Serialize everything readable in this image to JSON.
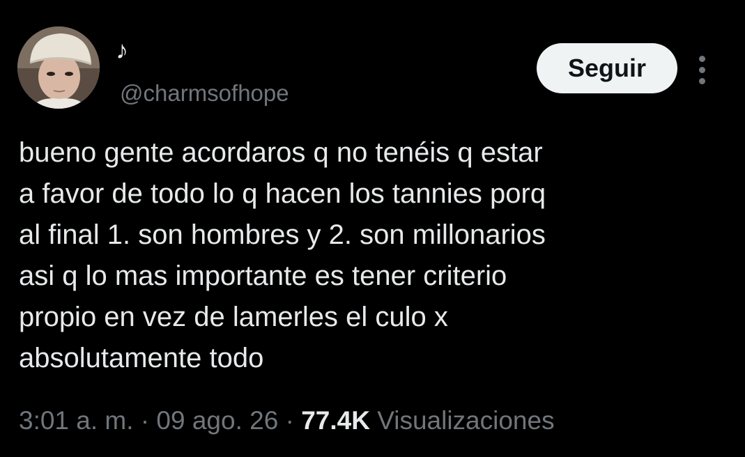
{
  "author": {
    "display_name": "♪",
    "handle": "@charmsofhope",
    "avatar_icon": "profile-photo"
  },
  "actions": {
    "follow_label": "Seguir",
    "more_icon": "more-options-icon"
  },
  "tweet": {
    "text": "bueno gente acordaros q no tenéis q estar\na favor de todo lo q hacen los tannies porq\nal final 1. son hombres y 2. son millonarios\nasi q lo mas importante es tener criterio\npropio en vez de lamerles el culo x\nabsolutamente todo"
  },
  "meta": {
    "time": "3:01 a. m.",
    "separator": "·",
    "date": "09 ago. 26",
    "views_count": "77.4K",
    "views_label": "Visualizaciones"
  },
  "colors": {
    "background": "#000000",
    "primary_text": "#e7e9ea",
    "secondary_text": "#71767b",
    "follow_button_bg": "#eff3f4",
    "follow_button_text": "#0f1419"
  }
}
